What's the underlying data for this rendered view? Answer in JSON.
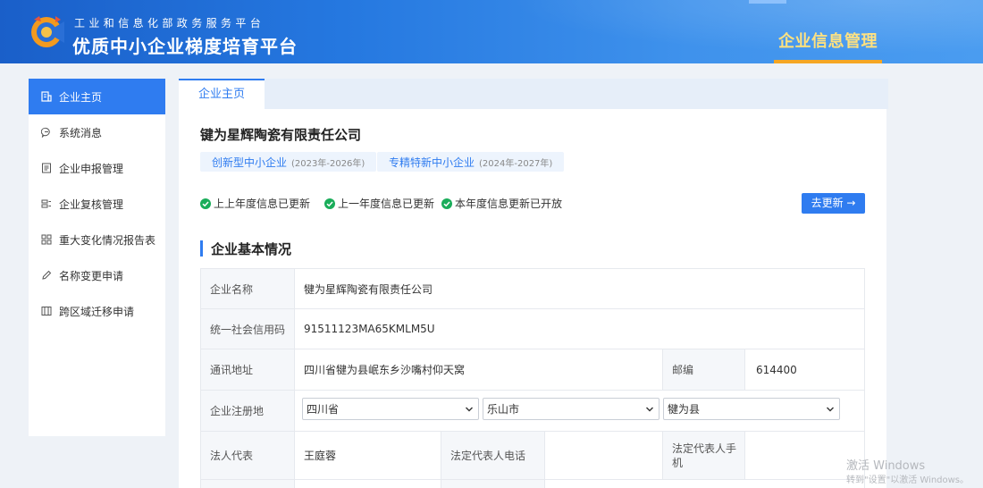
{
  "header": {
    "subtitle": "工业和信息化部政务服务平台",
    "title": "优质中小企业梯度培育平台",
    "nav_active": "企业信息管理"
  },
  "sidebar": {
    "items": [
      {
        "label": "企业主页",
        "icon": "home-doc-icon",
        "active": true
      },
      {
        "label": "系统消息",
        "icon": "message-icon",
        "active": false
      },
      {
        "label": "企业申报管理",
        "icon": "list-icon",
        "active": false
      },
      {
        "label": "企业复核管理",
        "icon": "review-icon",
        "active": false
      },
      {
        "label": "重大变化情况报告表",
        "icon": "grid-icon",
        "active": false
      },
      {
        "label": "名称变更申请",
        "icon": "pencil-icon",
        "active": false
      },
      {
        "label": "跨区域迁移申请",
        "icon": "transfer-icon",
        "active": false
      }
    ]
  },
  "tab": {
    "label": "企业主页"
  },
  "company": {
    "name": "键为星辉陶瓷有限责任公司",
    "badges": [
      {
        "name": "创新型中小企业",
        "period": "(2023年-2026年)"
      },
      {
        "name": "专精特新中小企业",
        "period": "(2024年-2027年)"
      }
    ],
    "status": [
      "上上年度信息已更新",
      "上一年度信息已更新",
      "本年度信息更新已开放"
    ],
    "update_button": "去更新 →"
  },
  "section": {
    "title": "企业基本情况"
  },
  "info": {
    "name_label": "企业名称",
    "name_value": "犍为星辉陶瓷有限责任公司",
    "credit_label": "统一社会信用码",
    "credit_value": "91511123MA65KMLM5U",
    "address_label": "通讯地址",
    "address_value": "四川省犍为县岷东乡沙嘴村仰天窝",
    "postcode_label": "邮编",
    "postcode_value": "614400",
    "reg_label": "企业注册地",
    "province": "四川省",
    "city": "乐山市",
    "county": "犍为县",
    "legal_label": "法人代表",
    "legal_value": "王庭蓉",
    "legal_phone_label": "法定代表人电话",
    "legal_phone_value": "",
    "legal_mobile_label": "法定代表人手机",
    "legal_mobile_value": ""
  },
  "watermark": {
    "line1": "激活 Windows",
    "line2": "转到\"设置\"以激活 Windows。"
  },
  "colors": {
    "primary": "#2f7cf0",
    "header_blue": "#2578e0",
    "accent_gold": "#f5a623",
    "check_green": "#1aad5a"
  }
}
